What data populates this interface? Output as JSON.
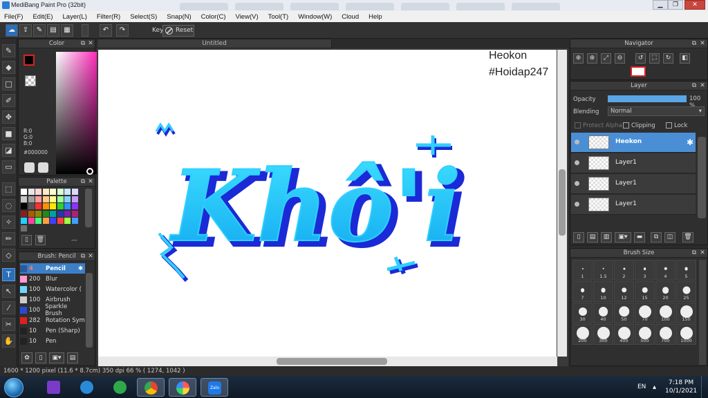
{
  "window": {
    "title": "MediBang Paint Pro (32bit)"
  },
  "menu": [
    "File(F)",
    "Edit(E)",
    "Layer(L)",
    "Filter(R)",
    "Select(S)",
    "Snap(N)",
    "Color(C)",
    "View(V)",
    "Tool(T)",
    "Window(W)",
    "Cloud",
    "Help"
  ],
  "toolbar": {
    "key_label": "Key",
    "reset_label": "Reset"
  },
  "color_panel": {
    "title": "Color",
    "r": "R:0",
    "g": "G:0",
    "b": "B:0",
    "hex": "#000000",
    "fg": "#000000",
    "accent": "#d22222"
  },
  "palette_panel": {
    "title": "Palette",
    "dash": "---",
    "swatches": [
      "#ffffff",
      "#e6e6e6",
      "#ffd6d6",
      "#ffe9c8",
      "#fffdc8",
      "#d6ffd6",
      "#c8e8ff",
      "#e2d6ff",
      "#c8c8c8",
      "#a0a0a0",
      "#ff9c9c",
      "#ffc98a",
      "#ffff8a",
      "#9cff9c",
      "#8acfff",
      "#c09cff",
      "#000000",
      "#555555",
      "#ff3030",
      "#ff9000",
      "#ffe800",
      "#30d030",
      "#3090ff",
      "#9030ff",
      "#8a1f1f",
      "#b05a00",
      "#8a8a00",
      "#1f8a1f",
      "#00a0a0",
      "#1f3ab0",
      "#7a1fb0",
      "#b01f7a",
      "#20d0ff",
      "#ff40a0",
      "#40ff80",
      "#ffa040",
      "#4040ff",
      "#ff4040",
      "#a0ff40",
      "#40a0ff",
      "#707070"
    ]
  },
  "brush_panel": {
    "title": "Brush: Pencil",
    "brushes": [
      {
        "size": "4",
        "name": "Pencil",
        "color": "#2a5a9a"
      },
      {
        "size": "200",
        "name": "Blur",
        "color": "#ff9ad5"
      },
      {
        "size": "100",
        "name": "Watercolor (",
        "color": "#6fd6ff"
      },
      {
        "size": "100",
        "name": "Airbrush",
        "color": "#cccccc"
      },
      {
        "size": "100",
        "name": "Sparkle Brush",
        "color": "#2a4ad6"
      },
      {
        "size": "282",
        "name": "Rotation Sym",
        "color": "#e02020"
      },
      {
        "size": "10",
        "name": "Pen (Sharp)",
        "color": "#222222"
      },
      {
        "size": "10",
        "name": "Pen",
        "color": "#222222"
      }
    ]
  },
  "canvas": {
    "tab_title": "Untitled",
    "watermark_name": "Heokon",
    "watermark_tag": "#Hoidap247",
    "art_text": "Khô'i"
  },
  "navigator": {
    "title": "Navigator"
  },
  "layer_panel": {
    "title": "Layer",
    "opacity_label": "Opacity",
    "opacity": 100,
    "opacity_text": "100 %",
    "blending_label": "Blending",
    "blending_value": "Normal",
    "protect_alpha": "Protect Alpha",
    "clipping": "Clipping",
    "lock": "Lock",
    "layers": [
      {
        "name": "Heokon",
        "selected": true
      },
      {
        "name": "Layer1",
        "selected": false
      },
      {
        "name": "Layer1",
        "selected": false
      },
      {
        "name": "Layer1",
        "selected": false
      }
    ]
  },
  "brush_size_panel": {
    "title": "Brush Size",
    "sizes": [
      "1",
      "1.5",
      "2",
      "3",
      "4",
      "5",
      "7",
      "10",
      "12",
      "15",
      "20",
      "25",
      "30",
      "40",
      "50",
      "70",
      "100",
      "150",
      "200",
      "300",
      "400",
      "500",
      "700",
      "1000"
    ]
  },
  "status_bar": {
    "text": "1600 * 1200 pixel   (11.6 * 8.7cm)   350 dpi   66 %   ( 1274, 1042 )"
  },
  "taskbar": {
    "lang": "EN",
    "time": "7:18 PM",
    "date": "10/1/2021",
    "zalo_label": "Zalo"
  }
}
